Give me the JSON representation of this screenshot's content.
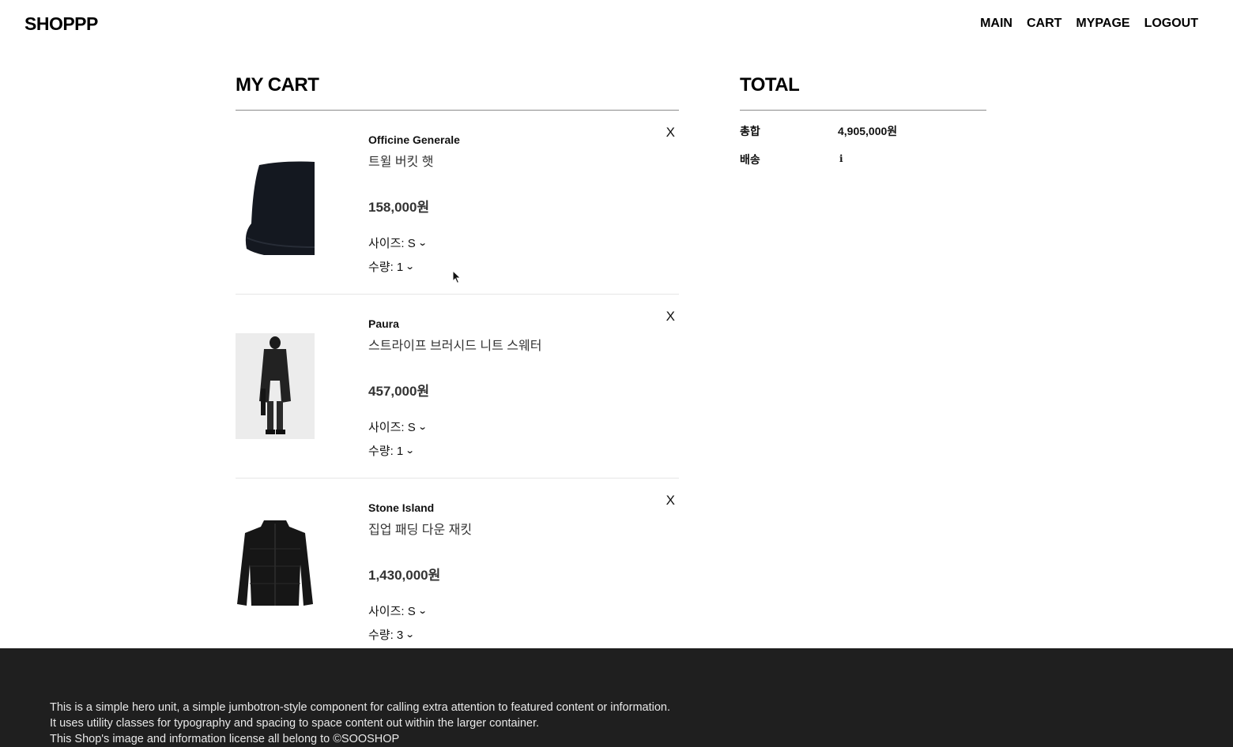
{
  "header": {
    "logo": "SHOPPP",
    "nav": [
      "MAIN",
      "CART",
      "MYPAGE",
      "LOGOUT"
    ]
  },
  "cart": {
    "title": "MY CART",
    "remove_label": "X",
    "items": [
      {
        "brand": "Officine Generale",
        "name": "트윌 버킷 햇",
        "price": "158,000원",
        "size": "사이즈: S",
        "qty": "수량: 1",
        "image_icon": "bucket-hat"
      },
      {
        "brand": "Paura",
        "name": "스트라이프 브러시드 니트 스웨터",
        "price": "457,000원",
        "size": "사이즈: S",
        "qty": "수량: 1",
        "image_icon": "model-coat"
      },
      {
        "brand": "Stone Island",
        "name": "집업 패딩 다운 재킷",
        "price": "1,430,000원",
        "size": "사이즈: S",
        "qty": "수량: 3",
        "image_icon": "puffer-jacket"
      }
    ]
  },
  "total": {
    "title": "TOTAL",
    "sum_label": "총합",
    "sum_value": "4,905,000원",
    "shipping_label": "배송",
    "shipping_icon": "info-icon",
    "shipping_glyph": "i"
  },
  "footer": {
    "lines": [
      "This is a simple hero unit, a simple jumbotron-style component for calling extra attention to featured content or information.",
      "It uses utility classes for typography and spacing to space content out within the larger container.",
      "This Shop's image and information license all belong to ©SOOSHOP"
    ]
  }
}
